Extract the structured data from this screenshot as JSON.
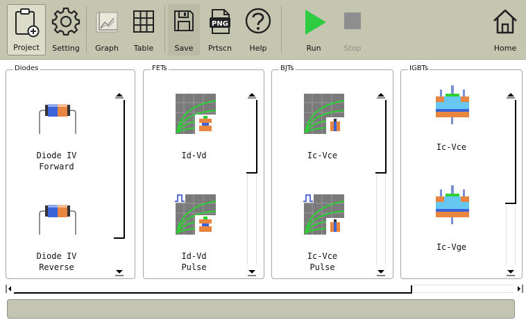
{
  "toolbar": {
    "project": "Project",
    "setting": "Setting",
    "graph": "Graph",
    "table": "Table",
    "save": "Save",
    "prtscn": "Prtscn",
    "png_badge": "PNG",
    "help": "Help",
    "run": "Run",
    "stop": "Stop",
    "home": "Home"
  },
  "icons": {
    "project": "clipboard-add-icon",
    "setting": "gear-icon",
    "graph": "chart-icon",
    "table": "grid-icon",
    "save": "floppy-icon",
    "prtscn": "png-file-icon",
    "help": "question-icon",
    "run": "play-icon",
    "stop": "stop-icon",
    "home": "home-icon"
  },
  "groups": {
    "diodes": {
      "title": "Diodes",
      "items": [
        "Diode IV\nForward",
        "Diode IV\nReverse"
      ]
    },
    "fets": {
      "title": "FETs",
      "items": [
        "Id-Vd",
        "Id-Vd\nPulse"
      ]
    },
    "bjts": {
      "title": "BJTs",
      "items": [
        "Ic-Vce",
        "Ic-Vce\nPulse"
      ]
    },
    "igbts": {
      "title": "IGBTs",
      "items": [
        "Ic-Vce",
        "Ic-Vge"
      ]
    }
  },
  "colors": {
    "toolbar_bg": "#c5c6b0",
    "run_green": "#2ecc40",
    "stop_gray": "#8e8e8e",
    "status_bg": "#c3c4b2"
  },
  "statusbar": {
    "text": ""
  }
}
